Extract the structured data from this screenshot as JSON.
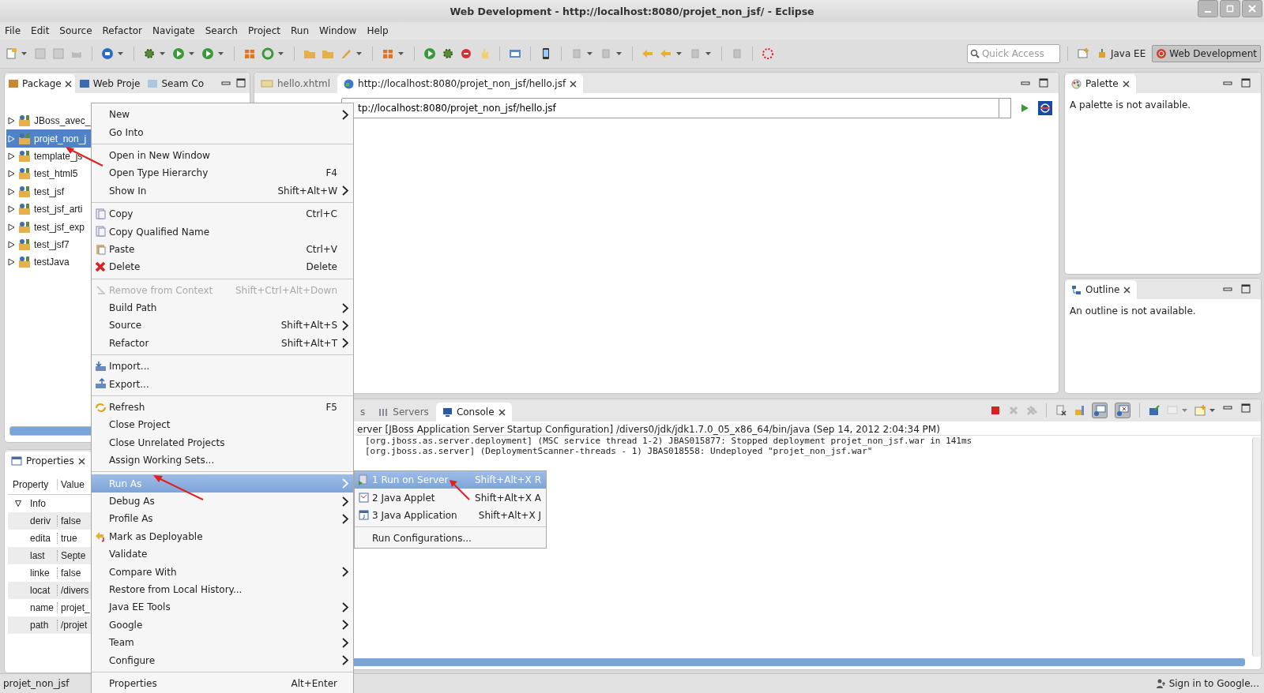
{
  "window": {
    "title": "Web Development - http://localhost:8080/projet_non_jsf/ - Eclipse"
  },
  "menubar": [
    "File",
    "Edit",
    "Source",
    "Refactor",
    "Navigate",
    "Search",
    "Project",
    "Run",
    "Window",
    "Help"
  ],
  "quick_access": {
    "placeholder": "Quick Access"
  },
  "perspectives": [
    {
      "label": "Java EE",
      "selected": false
    },
    {
      "label": "Web Development",
      "selected": true
    }
  ],
  "explorer": {
    "tabs": [
      {
        "label": "Package",
        "selected": true
      },
      {
        "label": "Web Proje",
        "selected": false
      },
      {
        "label": "Seam Co",
        "selected": false
      }
    ],
    "tree": [
      {
        "label": "JBoss_avec_",
        "selected": false,
        "expanded": false
      },
      {
        "label": "projet_non_j",
        "selected": true,
        "expanded": false
      },
      {
        "label": "template_js",
        "selected": false,
        "expanded": false
      },
      {
        "label": "test_html5",
        "selected": false,
        "expanded": false
      },
      {
        "label": "test_jsf",
        "selected": false,
        "expanded": false
      },
      {
        "label": "test_jsf_arti",
        "selected": false,
        "expanded": false
      },
      {
        "label": "test_jsf_exp",
        "selected": false,
        "expanded": false
      },
      {
        "label": "test_jsf7",
        "selected": false,
        "expanded": false
      },
      {
        "label": "testJava",
        "selected": false,
        "expanded": false
      }
    ]
  },
  "properties": {
    "tabs": [
      {
        "label": "Properties",
        "selected": true
      }
    ],
    "columns": [
      "Property",
      "Value"
    ],
    "group": {
      "label": "Info",
      "expanded": true
    },
    "rows": [
      {
        "property": "deriv",
        "value": "false"
      },
      {
        "property": "edita",
        "value": "true"
      },
      {
        "property": "last",
        "value": "Septe"
      },
      {
        "property": "linke",
        "value": "false"
      },
      {
        "property": "locat",
        "value": "/divers"
      },
      {
        "property": "name",
        "value": "projet_"
      },
      {
        "property": "path",
        "value": "/projet"
      }
    ]
  },
  "editor": {
    "tabs": [
      {
        "label": "hello.xhtml",
        "selected": false
      },
      {
        "label": "http://localhost:8080/projet_non_jsf/hello.jsf",
        "selected": true
      }
    ],
    "url": "tp://localhost:8080/projet_non_jsf/hello.jsf"
  },
  "palette": {
    "tabs": [
      {
        "label": "Palette",
        "selected": true
      }
    ],
    "message": "A palette is not available."
  },
  "outline": {
    "tabs": [
      {
        "label": "Outline",
        "selected": true
      }
    ],
    "message": "An outline is not available."
  },
  "console": {
    "tabs": [
      {
        "label": "s",
        "selected": false
      },
      {
        "label": "Servers",
        "selected": false
      },
      {
        "label": "Console",
        "selected": true
      }
    ],
    "header": "erver [JBoss Application Server Startup Configuration] /divers0/jdk/jdk1.7.0_05_x86_64/bin/java (Sep 14, 2012 2:04:34 PM)",
    "lines": [
      "[org.jboss.as.server.deployment] (MSC service thread 1-2) JBAS015877: Stopped deployment projet_non_jsf.war in 141ms",
      "[org.jboss.as.server] (DeploymentScanner-threads - 1) JBAS018558: Undeployed \"projet_non_jsf.war\""
    ]
  },
  "context_menu": [
    {
      "kind": "item",
      "label": "New",
      "submenu": true,
      "disabled": false,
      "selected": false
    },
    {
      "kind": "item",
      "label": "Go Into",
      "submenu": false,
      "disabled": false,
      "selected": false
    },
    {
      "kind": "separator"
    },
    {
      "kind": "item",
      "label": "Open in New Window",
      "submenu": false,
      "disabled": false,
      "selected": false
    },
    {
      "kind": "item",
      "label": "Open Type Hierarchy",
      "shortcut": "F4",
      "submenu": false,
      "disabled": false,
      "selected": false
    },
    {
      "kind": "item",
      "label": "Show In",
      "shortcut": "Shift+Alt+W",
      "submenu": true,
      "disabled": false,
      "selected": false
    },
    {
      "kind": "separator"
    },
    {
      "kind": "item",
      "label": "Copy",
      "shortcut": "Ctrl+C",
      "submenu": false,
      "disabled": false,
      "selected": false
    },
    {
      "kind": "item",
      "label": "Copy Qualified Name",
      "submenu": false,
      "disabled": false,
      "selected": false
    },
    {
      "kind": "item",
      "label": "Paste",
      "shortcut": "Ctrl+V",
      "submenu": false,
      "disabled": false,
      "selected": false
    },
    {
      "kind": "item",
      "label": "Delete",
      "shortcut": "Delete",
      "submenu": false,
      "disabled": false,
      "selected": false
    },
    {
      "kind": "separator"
    },
    {
      "kind": "item",
      "label": "Remove from Context",
      "shortcut": "Shift+Ctrl+Alt+Down",
      "submenu": false,
      "disabled": true,
      "selected": false
    },
    {
      "kind": "item",
      "label": "Build Path",
      "submenu": true,
      "disabled": false,
      "selected": false
    },
    {
      "kind": "item",
      "label": "Source",
      "shortcut": "Shift+Alt+S",
      "submenu": true,
      "disabled": false,
      "selected": false
    },
    {
      "kind": "item",
      "label": "Refactor",
      "shortcut": "Shift+Alt+T",
      "submenu": true,
      "disabled": false,
      "selected": false
    },
    {
      "kind": "separator"
    },
    {
      "kind": "item",
      "label": "Import...",
      "submenu": false,
      "disabled": false,
      "selected": false
    },
    {
      "kind": "item",
      "label": "Export...",
      "submenu": false,
      "disabled": false,
      "selected": false
    },
    {
      "kind": "separator"
    },
    {
      "kind": "item",
      "label": "Refresh",
      "shortcut": "F5",
      "submenu": false,
      "disabled": false,
      "selected": false
    },
    {
      "kind": "item",
      "label": "Close Project",
      "submenu": false,
      "disabled": false,
      "selected": false
    },
    {
      "kind": "item",
      "label": "Close Unrelated Projects",
      "submenu": false,
      "disabled": false,
      "selected": false
    },
    {
      "kind": "item",
      "label": "Assign Working Sets...",
      "submenu": false,
      "disabled": false,
      "selected": false
    },
    {
      "kind": "separator"
    },
    {
      "kind": "item",
      "label": "Run As",
      "submenu": true,
      "disabled": false,
      "selected": true
    },
    {
      "kind": "item",
      "label": "Debug As",
      "submenu": true,
      "disabled": false,
      "selected": false
    },
    {
      "kind": "item",
      "label": "Profile As",
      "submenu": true,
      "disabled": false,
      "selected": false
    },
    {
      "kind": "item",
      "label": "Mark as Deployable",
      "submenu": false,
      "disabled": false,
      "selected": false
    },
    {
      "kind": "item",
      "label": "Validate",
      "submenu": false,
      "disabled": false,
      "selected": false
    },
    {
      "kind": "item",
      "label": "Compare With",
      "submenu": true,
      "disabled": false,
      "selected": false
    },
    {
      "kind": "item",
      "label": "Restore from Local History...",
      "submenu": false,
      "disabled": false,
      "selected": false
    },
    {
      "kind": "item",
      "label": "Java EE Tools",
      "submenu": true,
      "disabled": false,
      "selected": false
    },
    {
      "kind": "item",
      "label": "Google",
      "submenu": true,
      "disabled": false,
      "selected": false
    },
    {
      "kind": "item",
      "label": "Team",
      "submenu": true,
      "disabled": false,
      "selected": false
    },
    {
      "kind": "item",
      "label": "Configure",
      "submenu": true,
      "disabled": false,
      "selected": false
    },
    {
      "kind": "separator"
    },
    {
      "kind": "item",
      "label": "Properties",
      "shortcut": "Alt+Enter",
      "submenu": false,
      "disabled": false,
      "selected": false
    }
  ],
  "run_as_menu": [
    {
      "kind": "item",
      "label": "1 Run on Server",
      "shortcut": "Shift+Alt+X R",
      "selected": true
    },
    {
      "kind": "item",
      "label": "2 Java Applet",
      "shortcut": "Shift+Alt+X A",
      "selected": false
    },
    {
      "kind": "item",
      "label": "3 Java Application",
      "shortcut": "Shift+Alt+X J",
      "selected": false
    },
    {
      "kind": "separator"
    },
    {
      "kind": "item",
      "label": "Run Configurations...",
      "selected": false
    }
  ],
  "status_bar": {
    "selection": "projet_non_jsf",
    "sign_in": "Sign in to Google..."
  }
}
